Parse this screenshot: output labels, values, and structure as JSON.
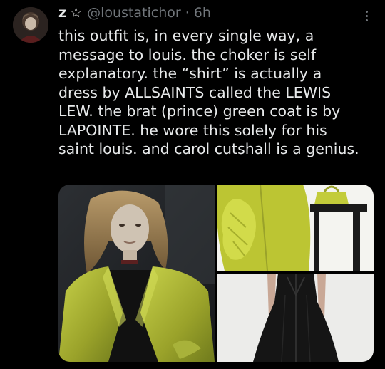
{
  "tweet": {
    "display_name": "z",
    "badge_icon": "star-icon",
    "handle": "@loustatichor",
    "separator": "·",
    "time": "6h",
    "more_icon": "more-vertical-icon",
    "text_lines": [
      "this outfit is, in every single way, a",
      "message to louis. the choker is self",
      "explanatory. the “shirt” is actually a",
      "dress by ALLSAINTS called the LEWIS",
      "LEW. the brat (prince) green coat is by",
      "LAPOINTE. he wore this solely for his",
      "saint louis. and carol cutshall is a genius."
    ]
  },
  "colors": {
    "background": "#000000",
    "text": "#e7e9ea",
    "muted": "#71767b",
    "coat_green": "#b8c236"
  }
}
